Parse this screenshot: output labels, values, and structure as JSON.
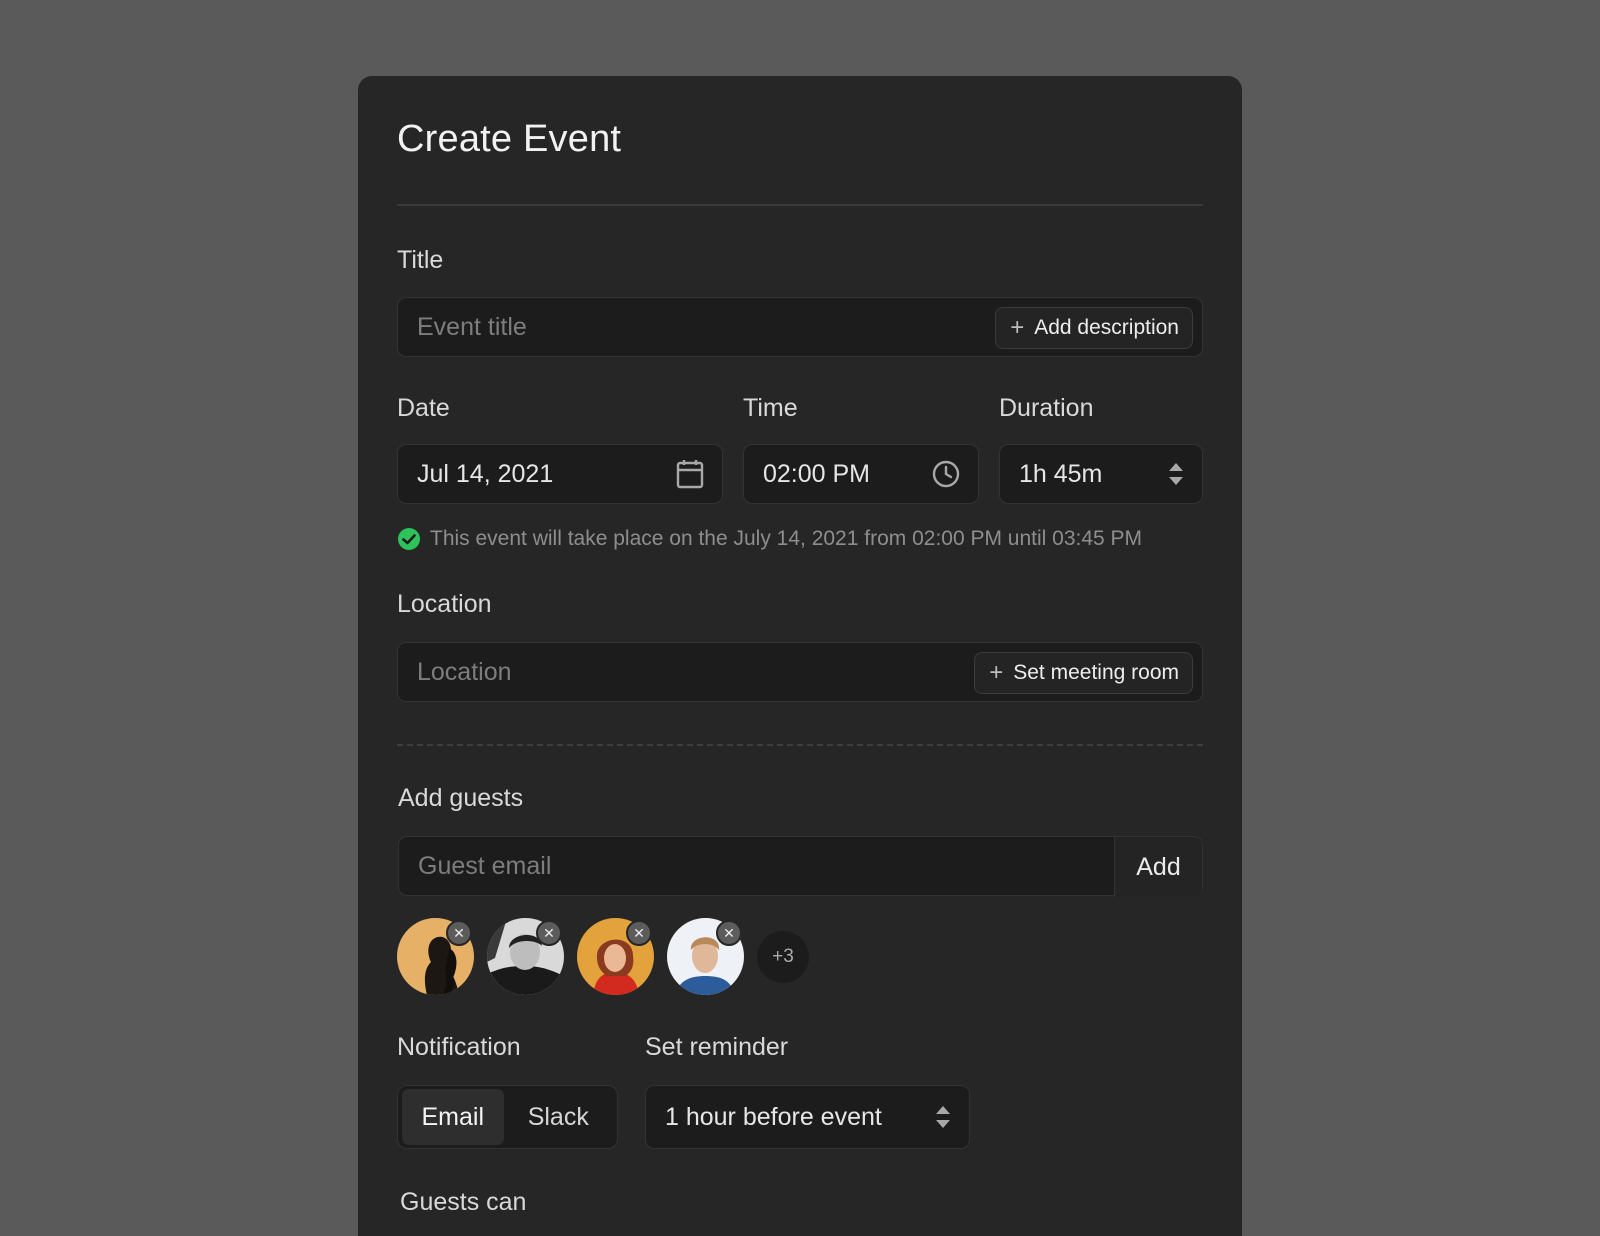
{
  "header": {
    "title": "Create Event"
  },
  "title_section": {
    "label": "Title",
    "placeholder": "Event title",
    "add_description_label": "Add description"
  },
  "date": {
    "label": "Date",
    "value": "Jul 14, 2021",
    "icon": "calendar-icon"
  },
  "time": {
    "label": "Time",
    "value": "02:00 PM",
    "icon": "clock-icon"
  },
  "duration": {
    "label": "Duration",
    "value": "1h 45m",
    "icon": "stepper-arrows-icon"
  },
  "summary": {
    "text": "This event will take place on the July 14, 2021 from 02:00 PM until 03:45 PM",
    "status_color": "#2ec25a"
  },
  "location": {
    "label": "Location",
    "placeholder": "Location",
    "set_room_label": "Set meeting room"
  },
  "guests": {
    "label": "Add guests",
    "placeholder": "Guest email",
    "add_label": "Add",
    "avatars": [
      {
        "name": "guest-avatar-1",
        "bg": "#e6b067"
      },
      {
        "name": "guest-avatar-2",
        "bg": "#d9d9d9"
      },
      {
        "name": "guest-avatar-3",
        "bg": "#e3a23c"
      },
      {
        "name": "guest-avatar-4",
        "bg": "#eef2f6"
      }
    ],
    "remove_glyph": "✕",
    "more_label": "+3"
  },
  "notification": {
    "label": "Notification",
    "options": [
      "Email",
      "Slack"
    ],
    "selected": "Email"
  },
  "reminder": {
    "label": "Set reminder",
    "value": "1 hour before event"
  },
  "guests_can": {
    "label": "Guests can"
  }
}
